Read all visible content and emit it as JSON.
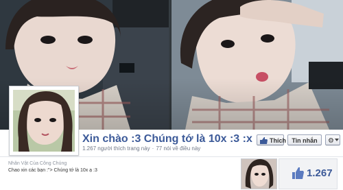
{
  "page": {
    "title": "Xin chào :3 Chúng tớ là 10x :3 :x",
    "likes_text": "1.267 người thích trang này",
    "talking_text": "77 nói về điều này",
    "separator": "·"
  },
  "actions": {
    "like_label": "Thích",
    "message_label": "Tin nhắn",
    "gear_icon": "gear-icon"
  },
  "about": {
    "category": "Nhân Vật Của Công Chúng",
    "text": "Chao xin các bạn :\"> Chúng tớ là 10x ạ :3"
  },
  "likes_box": {
    "count": "1.267",
    "icon": "thumbs-up-icon"
  },
  "colors": {
    "brand": "#3b5998",
    "button_face": "#f2f2f2"
  }
}
